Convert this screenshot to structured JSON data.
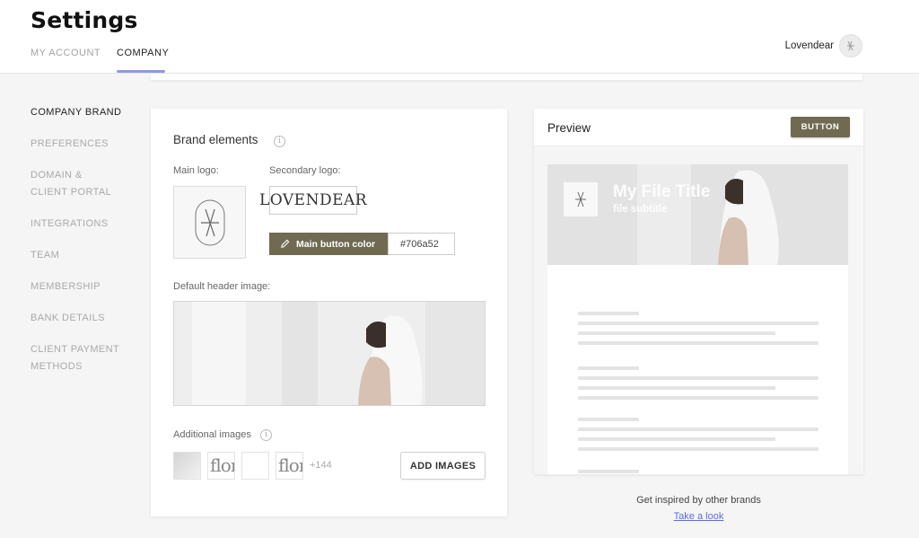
{
  "header": {
    "title": "Settings",
    "tabs": [
      {
        "label": "MY ACCOUNT",
        "active": false
      },
      {
        "label": "COMPANY",
        "active": true
      }
    ],
    "user_name": "Lovendear",
    "accent_color": "#8c9ae8"
  },
  "sidebar": {
    "items": [
      {
        "label": "COMPANY BRAND",
        "active": true
      },
      {
        "label": "PREFERENCES",
        "active": false
      },
      {
        "label": "DOMAIN & CLIENT PORTAL",
        "active": false
      },
      {
        "label": "INTEGRATIONS",
        "active": false
      },
      {
        "label": "TEAM",
        "active": false
      },
      {
        "label": "MEMBERSHIP",
        "active": false
      },
      {
        "label": "BANK DETAILS",
        "active": false
      },
      {
        "label": "CLIENT PAYMENT METHODS",
        "active": false
      }
    ]
  },
  "brand": {
    "title": "Brand elements",
    "main_logo_label": "Main logo:",
    "secondary_logo_label": "Secondary logo:",
    "secondary_logo_text": "LOVENDEAR",
    "main_button_color_label": "Main button color",
    "main_button_color_value": "#706a52",
    "header_image_label": "Default header image:",
    "additional_images_label": "Additional images",
    "additional_thumbs": [
      "",
      "flor",
      "",
      "flor"
    ],
    "additional_more": "+144",
    "add_images_label": "ADD IMAGES"
  },
  "preview": {
    "title": "Preview",
    "button_label": "BUTTON",
    "file_title": "My File Title",
    "file_subtitle": "file subtitle"
  },
  "inspiration": {
    "text": "Get inspired by other brands",
    "link": "Take a look"
  },
  "colors": {
    "brand_button": "#706a52",
    "link": "#5b6ed6"
  }
}
